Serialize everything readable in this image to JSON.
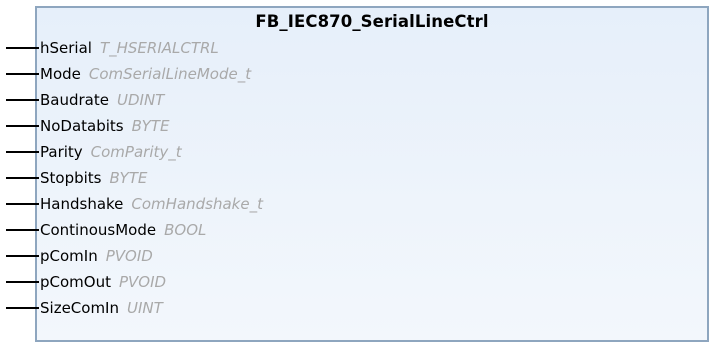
{
  "block": {
    "title": "FB_IEC870_SerialLineCtrl",
    "inputs": [
      {
        "name": "hSerial",
        "type": "T_HSERIALCTRL"
      },
      {
        "name": "Mode",
        "type": "ComSerialLineMode_t"
      },
      {
        "name": "Baudrate",
        "type": "UDINT"
      },
      {
        "name": "NoDatabits",
        "type": "BYTE"
      },
      {
        "name": "Parity",
        "type": "ComParity_t"
      },
      {
        "name": "Stopbits",
        "type": "BYTE"
      },
      {
        "name": "Handshake",
        "type": "ComHandshake_t"
      },
      {
        "name": "ContinousMode",
        "type": "BOOL"
      },
      {
        "name": "pComIn",
        "type": "PVOID"
      },
      {
        "name": "pComOut",
        "type": "PVOID"
      },
      {
        "name": "SizeComIn",
        "type": "UINT"
      }
    ]
  },
  "colors": {
    "border": "#8ea6bf",
    "fill": "#e6effa",
    "pin_name": "#000000",
    "pin_type": "#a9a9a9"
  }
}
